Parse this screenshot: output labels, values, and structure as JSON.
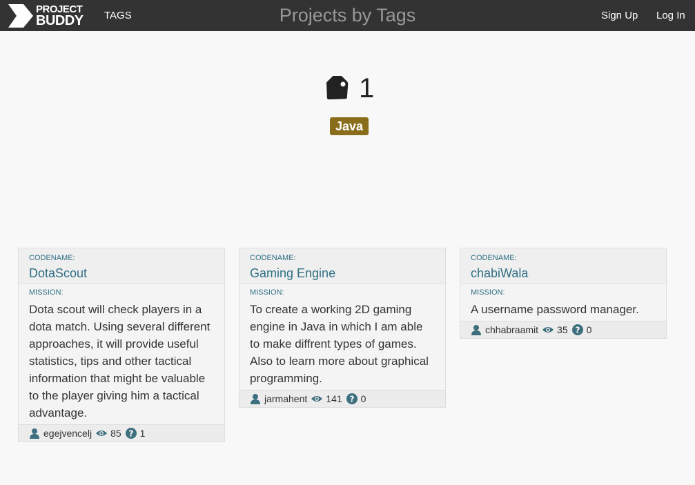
{
  "navbar": {
    "logo_line1": "PROJECT",
    "logo_line2": "BUDDY",
    "tags_link": "TAGS",
    "heading": "Projects by Tags",
    "signup": "Sign Up",
    "login": "Log In"
  },
  "tag": {
    "count": "1",
    "label": "Java"
  },
  "labels": {
    "codename": "CODENAME:",
    "mission": "MISSION:"
  },
  "projects": [
    {
      "codename": "DotaScout",
      "mission": "Dota scout will check players in a dota match. Using several different approaches, it will provide useful statistics, tips and other tactical information that might be valuable to the player giving him a tactical advantage.",
      "author": "egejvencelj",
      "views": "85",
      "questions": "1"
    },
    {
      "codename": "Gaming Engine",
      "mission": "To create a working 2D gaming engine in Java in which I am able to make diffrent types of games. Also to learn more about graphical programming.",
      "author": "jarmahent",
      "views": "141",
      "questions": "0"
    },
    {
      "codename": "chabiWala",
      "mission": "A username password manager.",
      "author": "chhabraamit",
      "views": "35",
      "questions": "0"
    }
  ],
  "colors": {
    "navbar": "#333333",
    "tag_badge": "#8a6d1a",
    "link": "#2f6f84",
    "icon": "#3d6f7f"
  }
}
